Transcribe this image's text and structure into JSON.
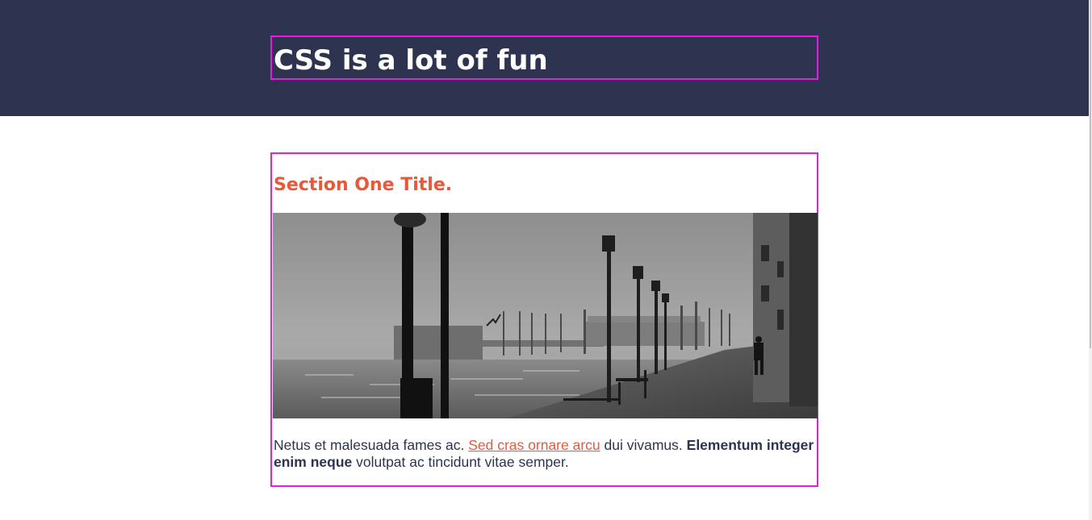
{
  "header": {
    "title": "CSS is a lot of fun"
  },
  "section": {
    "title": "Section One Title.",
    "image_alt": "Foggy black and white waterfront promenade with lamp posts",
    "paragraph": {
      "text_before": "Netus et malesuada fames ac. ",
      "link_text": "Sed cras ornare arcu",
      "text_middle": " dui vivamus. ",
      "bold_text": "Elementum integer enim neque",
      "text_after": " volutpat ac tincidunt vitae semper."
    }
  },
  "colors": {
    "header_bg": "#2e3450",
    "accent": "#e8583b",
    "outline": "#ee17e5",
    "text": "#2e3450"
  }
}
